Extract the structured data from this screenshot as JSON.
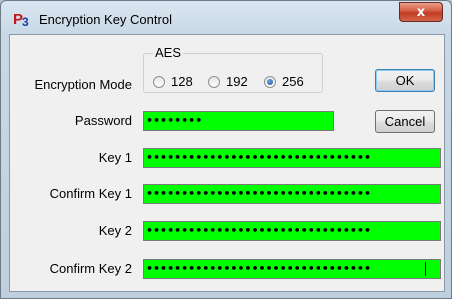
{
  "window": {
    "title": "Encryption Key Control",
    "icon_letter": "P",
    "icon_sub": "3",
    "close_glyph": "x"
  },
  "encryption_mode": {
    "label": "Encryption Mode",
    "group_label": "AES",
    "options": [
      "128",
      "192",
      "256"
    ],
    "selected": "256"
  },
  "fields": {
    "password": {
      "label": "Password",
      "value": "••••••••"
    },
    "key1": {
      "label": "Key 1",
      "value": "••••••••••••••••••••••••••••••••"
    },
    "confirm_key1": {
      "label": "Confirm Key 1",
      "value": "••••••••••••••••••••••••••••••••"
    },
    "key2": {
      "label": "Key 2",
      "value": "••••••••••••••••••••••••••••••••"
    },
    "confirm_key2": {
      "label": "Confirm Key 2",
      "value": "••••••••••••••••••••••••••••••••"
    }
  },
  "buttons": {
    "ok": "OK",
    "cancel": "Cancel"
  },
  "colors": {
    "field_bg": "#00ff00"
  }
}
